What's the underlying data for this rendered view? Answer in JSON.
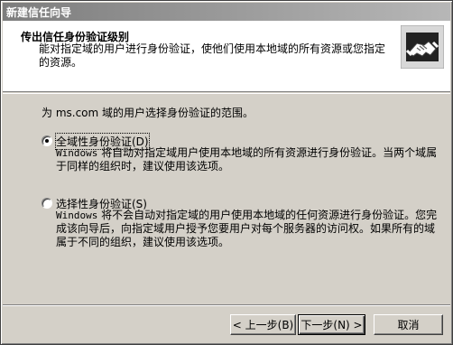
{
  "window": {
    "title": "新建信任向导"
  },
  "header": {
    "title": "传出信任身份验证级别",
    "description": "能对指定域的用户进行身份验证，使他们使用本地域的所有资源或您指定的资源。",
    "icon": "handshake-icon"
  },
  "main": {
    "instruction": "为 ms.com 域的用户选择身份验证的范围。",
    "options": [
      {
        "label": "全域性身份验证(D)",
        "selected": true,
        "description_prefix": "Windows",
        "description": " 将自动对指定域用户使用本地域的所有资源进行身份验证。当两个域属于同样的组织时，建议使用该选项。"
      },
      {
        "label": "选择性身份验证(S)",
        "selected": false,
        "description_prefix": "Windows",
        "description": " 将不会自动对指定域的用户使用本地域的任何资源进行身份验证。您完成该向导后，向指定域用户授予您要用户对每个服务器的访问权。如果所有的域属于不同的组织，建议使用该选项。"
      }
    ]
  },
  "footer": {
    "back_label": "< 上一步(B)",
    "next_label": "下一步(N) >",
    "cancel_label": "取消"
  }
}
